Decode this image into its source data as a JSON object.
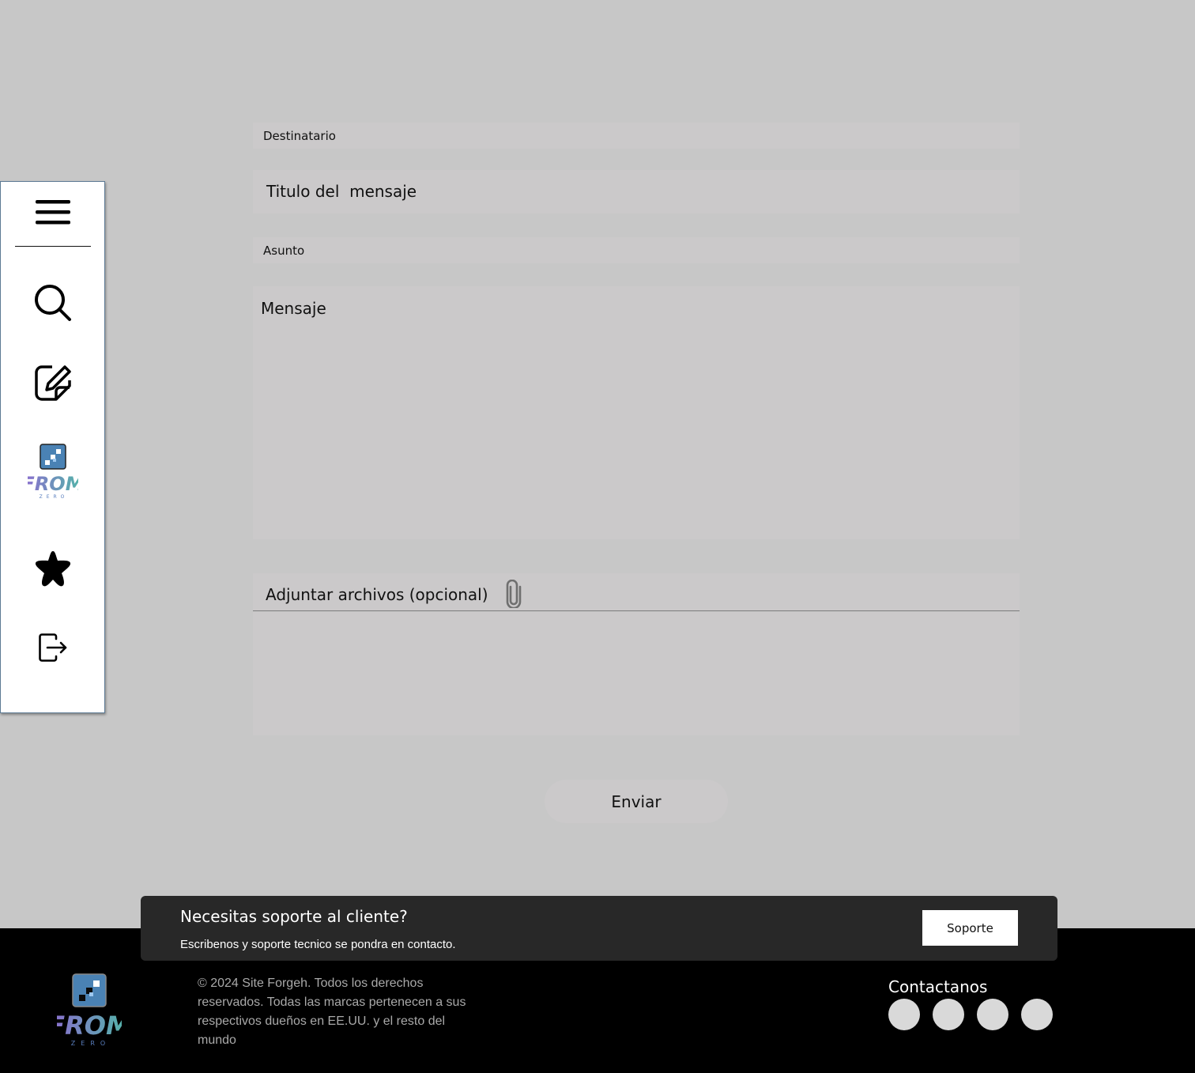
{
  "sidebar": {
    "items": [
      {
        "icon": "menu-icon"
      },
      {
        "icon": "search-icon"
      },
      {
        "icon": "edit-icon"
      },
      {
        "icon": "from-zero-logo",
        "logo_text": "FROM",
        "logo_subtext": "ZERO"
      },
      {
        "icon": "star-icon"
      },
      {
        "icon": "logout-icon"
      }
    ]
  },
  "form": {
    "recipient_label": "Destinatario",
    "title_label": "Titulo del  mensaje",
    "subject_label": "Asunto",
    "message_label": "Mensaje",
    "attach_label": "Adjuntar archivos (opcional)",
    "attach_icon": "paperclip-icon",
    "send_label": "Enviar"
  },
  "support": {
    "title": "Necesitas soporte al cliente?",
    "subtitle": "Escribenos y soporte tecnico se pondra en contacto.",
    "button_label": "Soporte"
  },
  "footer": {
    "logo_text": "FROM",
    "logo_subtext": "ZERO",
    "copyright": "© 2024 Site Forgeh. Todos los derechos reservados. Todas las marcas pertenecen a sus respectivos dueños en EE.UU. y el resto del mundo",
    "contact_title": "Contactanos",
    "social_count": 4
  },
  "colors": {
    "background": "#c7c7c7",
    "field": "#cbc9ca",
    "footer": "#000000",
    "banner": "#282828",
    "logo_gradient": [
      "#8e6bd1",
      "#4fb8a6"
    ]
  }
}
